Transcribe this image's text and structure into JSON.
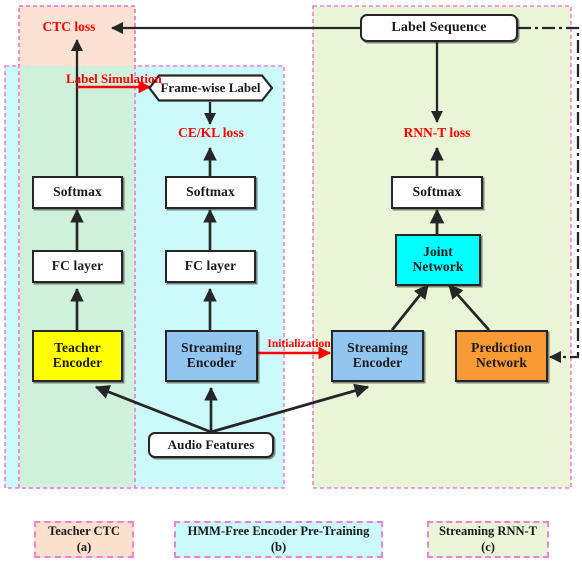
{
  "figure": {
    "title": "Teacher CTC / HMM-Free Encoder Pre-Training / Streaming RNN-T pipeline diagram",
    "colors": {
      "teacher_encoder": "#FFFF00",
      "streaming_encoder": "#92C5F0",
      "joint_network": "#00FFFF",
      "prediction_network": "#F89A35",
      "region_a_fill": "#FBE0CE",
      "region_b_fill": "#CCFAFB",
      "region_c_fill": "#EAF5D8",
      "region_border": "#F07FD8",
      "loss_text": "#FF0000",
      "edge": "#262626"
    }
  },
  "regions": [
    {
      "id": "a",
      "name": "Teacher CTC",
      "fill": "#FBE0CE"
    },
    {
      "id": "b",
      "name": "HMM-Free Encoder Pre-Training",
      "fill": "#CCFAFB"
    },
    {
      "id": "c",
      "name": "Streaming RNN-T",
      "fill": "#EAF5D8"
    }
  ],
  "nodes": {
    "label_sequence": "Label Sequence",
    "frame_wise_label": "Frame-wise Label",
    "audio_features": "Audio Features",
    "softmax_a": "Softmax",
    "softmax_b": "Softmax",
    "softmax_c": "Softmax",
    "fc_layer_a": "FC layer",
    "fc_layer_b": "FC layer",
    "teacher_encoder_l1": "Teacher",
    "teacher_encoder_l2": "Encoder",
    "streaming_encoder_b_l1": "Streaming",
    "streaming_encoder_b_l2": "Encoder",
    "streaming_encoder_c_l1": "Streaming",
    "streaming_encoder_c_l2": "Encoder",
    "joint_network_l1": "Joint",
    "joint_network_l2": "Network",
    "prediction_network_l1": "Prediction",
    "prediction_network_l2": "Network"
  },
  "edge_labels": {
    "ctc_loss": "CTC loss",
    "ce_kl_loss": "CE/KL loss",
    "rnnt_loss": "RNN-T loss",
    "label_sim_l1": "Label",
    "label_sim_l2": "Simulation",
    "initialization": "Initialization"
  },
  "legend": [
    {
      "name": "Teacher CTC",
      "tag": "(a)"
    },
    {
      "name": "HMM-Free Encoder Pre-Training",
      "tag": "(b)"
    },
    {
      "name": "Streaming RNN-T",
      "tag": "(c)"
    }
  ]
}
